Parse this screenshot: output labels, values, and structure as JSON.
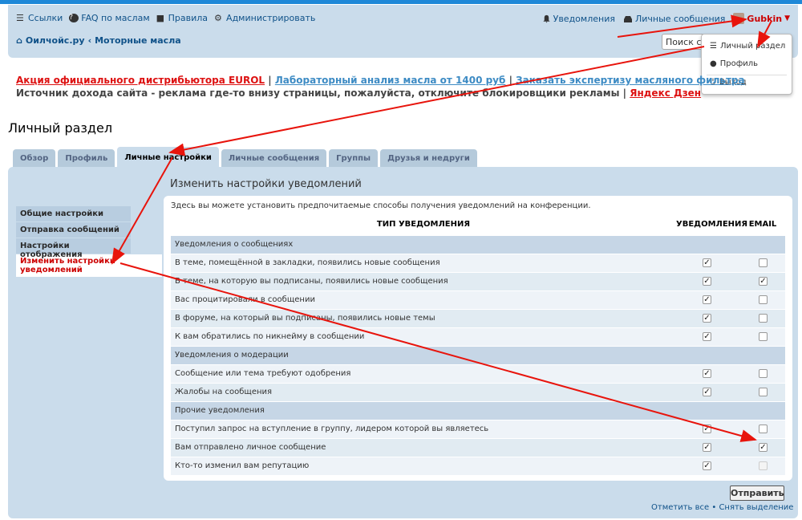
{
  "header": {
    "links": [
      {
        "icon": "menu-icon",
        "glyph": "☰",
        "label": "Ссылки"
      },
      {
        "icon": "question-icon",
        "glyph": "?",
        "label": "FAQ по маслам"
      },
      {
        "icon": "book-icon",
        "glyph": "■",
        "label": "Правила"
      },
      {
        "icon": "gears-icon",
        "glyph": "⚙",
        "label": "Администрировать"
      }
    ],
    "notifications": "Уведомления",
    "messages": "Личные сообщения",
    "username": "Gubkin",
    "breadcrumb": {
      "home": "Оилчойс.ру",
      "section": "Моторные масла"
    },
    "search_placeholder": "Поиск с"
  },
  "user_menu": {
    "items": [
      {
        "icon": "sliders-icon",
        "label": "Личный раздел"
      },
      {
        "icon": "user-icon",
        "label": "Профиль"
      },
      {
        "icon": "power-icon",
        "label": "Выход"
      }
    ]
  },
  "ads": {
    "line1": {
      "ad1": "Акция официального дистрибьютора EUROL",
      "ad2": "Лабораторный анализ масла от 1400 руб",
      "ad3": "Заказать экспертизу масляного фильтра"
    },
    "line2": {
      "text": "Источник дохода сайта - реклама где-то внизу страницы, пожалуйста, отключите блокировщики рекламы",
      "ad4": "Яндекс Дзен"
    },
    "sep": " | "
  },
  "page_title": "Личный раздел",
  "tabs": [
    "Обзор",
    "Профиль",
    "Личные настройки",
    "Личные сообщения",
    "Группы",
    "Друзья и недруги"
  ],
  "sidenav": [
    "Общие настройки",
    "Отправка сообщений",
    "Настройки отображения",
    "Изменить настройки уведомлений"
  ],
  "section_title": "Изменить настройки уведомлений",
  "intro": "Здесь вы можете установить предпочитаемые способы получения уведомлений на конференции.",
  "table": {
    "col_type": "ТИП УВЕДОМЛЕНИЯ",
    "col_notify": "УВЕДОМЛЕНИЯ",
    "col_email": "EMAIL",
    "rows": [
      {
        "cat": true,
        "label": "Уведомления о сообщениях"
      },
      {
        "label": "В теме, помещённой в закладки, появились новые сообщения",
        "notify": true,
        "email": false
      },
      {
        "label": "В теме, на которую вы подписаны, появились новые сообщения",
        "notify": true,
        "email": true
      },
      {
        "label": "Вас процитировали в сообщении",
        "notify": true,
        "email": false
      },
      {
        "label": "В форуме, на который вы подписаны, появились новые темы",
        "notify": true,
        "email": false
      },
      {
        "label": "К вам обратились по никнейму в сообщении",
        "notify": true,
        "email": false
      },
      {
        "cat": true,
        "label": "Уведомления о модерации"
      },
      {
        "label": "Сообщение или тема требуют одобрения",
        "notify": true,
        "email": false
      },
      {
        "label": "Жалобы на сообщения",
        "notify": true,
        "email": false
      },
      {
        "cat": true,
        "label": "Прочие уведомления"
      },
      {
        "label": "Поступил запрос на вступление в группу, лидером которой вы являетесь",
        "notify": true,
        "email": false
      },
      {
        "label": "Вам отправлено личное сообщение",
        "notify": true,
        "email": true
      },
      {
        "label": "Кто-то изменил вам репутацию",
        "notify": true,
        "email": false,
        "email_disabled": true
      }
    ]
  },
  "submit_label": "Отправить",
  "mark_all": "Отметить все",
  "unmark_all": "Снять выделение",
  "mark_sep": " • ",
  "annotation_color": "#e8140c"
}
